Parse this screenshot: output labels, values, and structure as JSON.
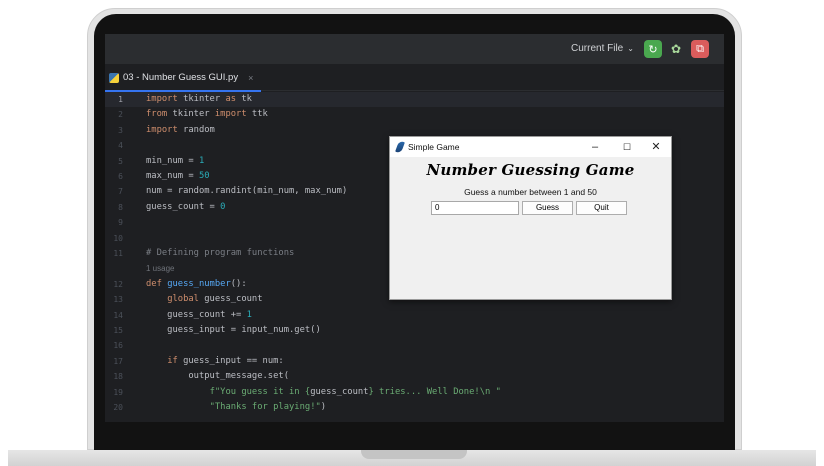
{
  "toolbar": {
    "current_file_label": "Current File",
    "chevron": "⌄",
    "run_icon": "run-icon",
    "debug_icon": "debug-icon",
    "stop_icon": "stop-icon"
  },
  "tab": {
    "filename": "03 - Number Guess GUI.py",
    "close": "×"
  },
  "editor": {
    "lines": [
      {
        "n": "1",
        "code": [
          [
            "kw",
            "import"
          ],
          [
            "plain",
            " tkinter "
          ],
          [
            "kw",
            "as"
          ],
          [
            "plain",
            " tk"
          ]
        ]
      },
      {
        "n": "2",
        "code": [
          [
            "kw",
            "from"
          ],
          [
            "plain",
            " tkinter "
          ],
          [
            "kw",
            "import"
          ],
          [
            "plain",
            " ttk"
          ]
        ]
      },
      {
        "n": "3",
        "code": [
          [
            "kw",
            "import"
          ],
          [
            "plain",
            " random"
          ]
        ]
      },
      {
        "n": "4",
        "code": []
      },
      {
        "n": "5",
        "code": [
          [
            "plain",
            "min_num = "
          ],
          [
            "num",
            "1"
          ]
        ]
      },
      {
        "n": "6",
        "code": [
          [
            "plain",
            "max_num = "
          ],
          [
            "num",
            "50"
          ]
        ]
      },
      {
        "n": "7",
        "code": [
          [
            "plain",
            "num = random.randint(min_num, max_num)"
          ]
        ]
      },
      {
        "n": "8",
        "code": [
          [
            "plain",
            "guess_count = "
          ],
          [
            "num",
            "0"
          ]
        ]
      },
      {
        "n": "9",
        "code": []
      },
      {
        "n": "10",
        "code": []
      },
      {
        "n": "11",
        "code": [
          [
            "cm",
            "# Defining program functions"
          ]
        ]
      },
      {
        "n": "",
        "hint": "1 usage"
      },
      {
        "n": "12",
        "code": [
          [
            "kw",
            "def "
          ],
          [
            "fn",
            "guess_number"
          ],
          [
            "plain",
            "():"
          ]
        ]
      },
      {
        "n": "13",
        "code": [
          [
            "plain",
            "    "
          ],
          [
            "kw",
            "global"
          ],
          [
            "plain",
            " guess_count"
          ]
        ]
      },
      {
        "n": "14",
        "code": [
          [
            "plain",
            "    guess_count += "
          ],
          [
            "num",
            "1"
          ]
        ]
      },
      {
        "n": "15",
        "code": [
          [
            "plain",
            "    guess_input = input_num.get()"
          ]
        ]
      },
      {
        "n": "16",
        "code": []
      },
      {
        "n": "17",
        "code": [
          [
            "plain",
            "    "
          ],
          [
            "kw",
            "if"
          ],
          [
            "plain",
            " guess_input == num:"
          ]
        ]
      },
      {
        "n": "18",
        "code": [
          [
            "plain",
            "        output_message.set("
          ]
        ]
      },
      {
        "n": "19",
        "code": [
          [
            "plain",
            "            "
          ],
          [
            "str",
            "f\"You guess it in {"
          ],
          [
            "plain",
            "guess_count"
          ],
          [
            "str",
            "} tries... Well Done!\\n \""
          ]
        ]
      },
      {
        "n": "20",
        "code": [
          [
            "plain",
            "            "
          ],
          [
            "str",
            "\"Thanks for playing!\""
          ],
          [
            "plain",
            ")"
          ]
        ]
      }
    ]
  },
  "game_window": {
    "title": "Simple Game",
    "minimize": "–",
    "maximize": "☐",
    "close": "✕",
    "heading": "Number Guessing Game",
    "prompt": "Guess a number between 1 and 50",
    "entry_value": "0",
    "guess_button": "Guess",
    "quit_button": "Quit"
  }
}
